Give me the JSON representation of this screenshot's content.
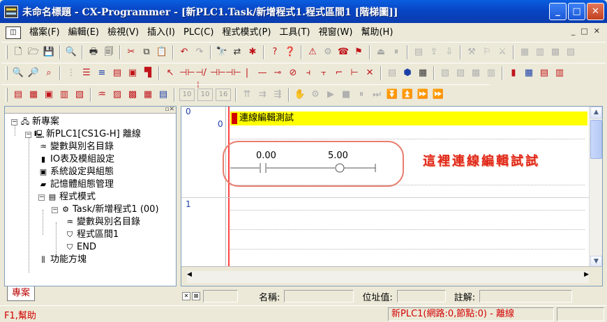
{
  "window": {
    "title": "未命名標題 - CX-Programmer - [新PLC1.Task/新增程式1.程式區間1 [階梯圖]]",
    "minimize_label": "_",
    "maximize_label": "□",
    "close_label": "✕"
  },
  "menu": {
    "items": [
      "檔案(F)",
      "編輯(E)",
      "檢視(V)",
      "插入(I)",
      "PLC(C)",
      "程式模式(P)",
      "工具(T)",
      "視窗(W)",
      "幫助(H)"
    ],
    "mdi_controls": [
      "_",
      "□",
      "✕"
    ]
  },
  "toolbar3": {
    "num_buttons": [
      "10",
      "10",
      "16"
    ]
  },
  "project_tree": {
    "root": "新專案",
    "plc": "新PLC1[CS1G-H] 離線",
    "plc_children": [
      "變數與別名目錄",
      "IO表及模組設定",
      "系統設定與組態",
      "記憶體組態管理"
    ],
    "programs": "程式模式",
    "task": "Task/新增程式1 (00)",
    "task_children": [
      "變數與別名目錄",
      "程式區間1",
      "END"
    ],
    "function_blocks": "功能方塊",
    "tab_label": "專案"
  },
  "ladder": {
    "rung0_number": "0",
    "rung0_step": "0",
    "rung1_number": "1",
    "rung0_comment": "連線編輯測試",
    "contact_address": "0.00",
    "coil_address": "5.00",
    "annotation": "這裡連線編輯試試"
  },
  "info_bar": {
    "name_label": "名稱:",
    "address_label": "位址值:",
    "comment_label": "註解:"
  },
  "status_bar": {
    "help": "F1,幫助",
    "plc_status": "新PLC1(網路:0,節點:0) - 離線"
  },
  "colors": {
    "title_bar": "#0845c4",
    "comment_bar": "#ffff00",
    "power_rail": "#ff4444",
    "annotation": "#e0281a",
    "callout_border": "#e87e6e"
  }
}
